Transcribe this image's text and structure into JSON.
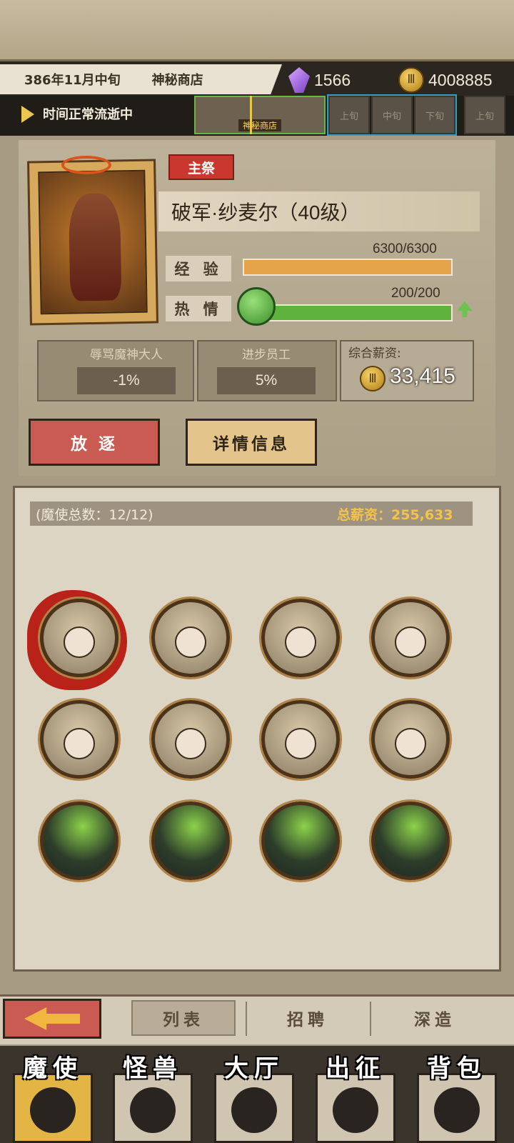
{
  "header": {
    "date": "386年11月中旬",
    "location": "神秘商店",
    "crystal_count": "1566",
    "gold_count": "4008885",
    "time_status": "时间正常流逝中",
    "timeline_current_label": "神秘商店",
    "timeline_slots": [
      "上旬",
      "中旬",
      "下旬",
      "上旬"
    ]
  },
  "character": {
    "role": "主祭",
    "name": "破军·纱麦尔（40级）",
    "exp_label": "经 验",
    "exp_value": "6300/6300",
    "exp_progress": 1.0,
    "passion_label": "热 情",
    "passion_value": "200/200",
    "passion_progress": 1.0,
    "trait1_title": "辱骂魔神大人",
    "trait1_value": "-1%",
    "trait2_title": "进步员工",
    "trait2_value": "5%",
    "salary_title": "综合薪资:",
    "salary_value": "33,415",
    "exile_button": "放 逐",
    "details_button": "详情信息"
  },
  "roster": {
    "count_label": "(魔使总数：12/12)",
    "total_salary_label": "总薪资：255,633",
    "members": [
      {
        "name": "avatar-1",
        "selected": true
      },
      {
        "name": "avatar-2"
      },
      {
        "name": "avatar-3"
      },
      {
        "name": "avatar-4"
      },
      {
        "name": "avatar-5"
      },
      {
        "name": "avatar-6"
      },
      {
        "name": "avatar-7"
      },
      {
        "name": "avatar-8"
      },
      {
        "name": "avatar-9",
        "locked": true
      },
      {
        "name": "avatar-10",
        "locked": true
      },
      {
        "name": "avatar-11",
        "locked": true
      },
      {
        "name": "avatar-12",
        "locked": true
      }
    ]
  },
  "tabs": {
    "list": "列表",
    "recruit": "招聘",
    "forge": "深造"
  },
  "nav": {
    "envoy": "魔使",
    "monster": "怪兽",
    "hall": "大厅",
    "expedition": "出征",
    "bag": "背包"
  },
  "colors": {
    "exp_bar": "#e6a44a",
    "passion_bar": "#5fb23e",
    "salary_gold": "#f5c24a",
    "danger_button": "#c95b52",
    "detail_button": "#e3c48a"
  }
}
